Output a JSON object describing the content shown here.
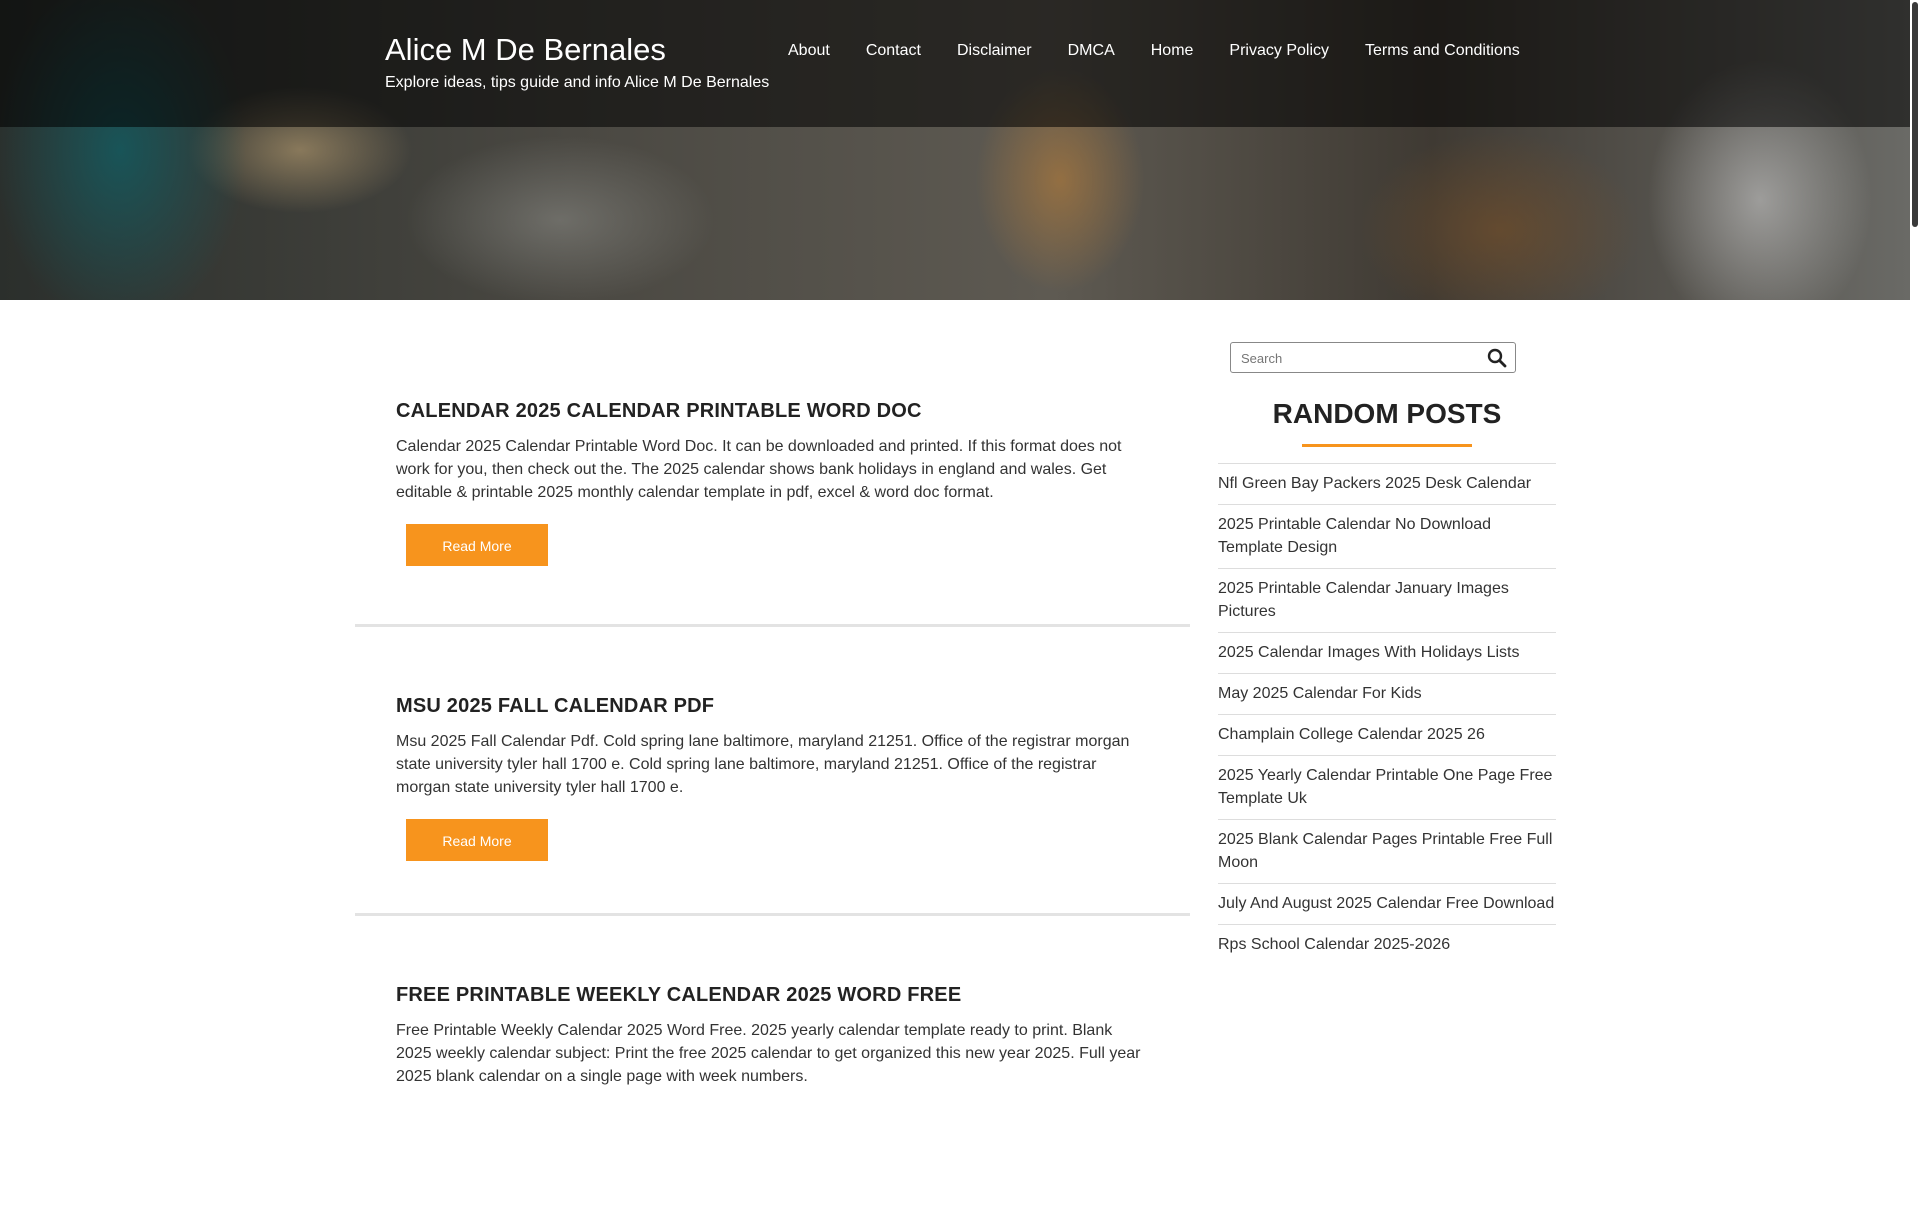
{
  "site": {
    "title": "Alice M De Bernales",
    "tagline": "Explore ideas, tips guide and info Alice M De Bernales"
  },
  "nav": {
    "items": [
      {
        "label": "About"
      },
      {
        "label": "Contact"
      },
      {
        "label": "Disclaimer"
      },
      {
        "label": "DMCA"
      },
      {
        "label": "Home"
      },
      {
        "label": "Privacy Policy"
      },
      {
        "label": "Terms and Conditions"
      }
    ]
  },
  "posts": [
    {
      "title": "CALENDAR 2025 CALENDAR PRINTABLE WORD DOC",
      "excerpt": "Calendar 2025 Calendar Printable Word Doc. It can be downloaded and printed. If this format does not work for you, then check out the. The 2025 calendar shows bank holidays in england and wales. Get editable & printable 2025 monthly calendar template in pdf, excel & word doc format.",
      "button": "Read More"
    },
    {
      "title": "MSU 2025 FALL CALENDAR PDF",
      "excerpt": "Msu 2025 Fall Calendar Pdf. Cold spring lane baltimore, maryland 21251. Office of the registrar morgan state university tyler hall 1700 e. Cold spring lane baltimore, maryland 21251. Office of the registrar morgan state university tyler hall 1700 e.",
      "button": "Read More"
    },
    {
      "title": "FREE PRINTABLE WEEKLY CALENDAR 2025 WORD FREE",
      "excerpt": "Free Printable Weekly Calendar 2025 Word Free. 2025 yearly calendar template ready to print. Blank 2025 weekly calendar subject: Print the free 2025 calendar to get organized this new year 2025. Full year 2025 blank calendar on a single page with week numbers."
    }
  ],
  "sidebar": {
    "search_placeholder": "Search",
    "search_icon": "magnifier-icon",
    "widget_title": "RANDOM POSTS",
    "random_posts": [
      "Nfl Green Bay Packers 2025 Desk Calendar",
      "2025 Printable Calendar No Download Template Design",
      "2025 Printable Calendar January Images Pictures",
      "2025 Calendar Images With Holidays Lists",
      "May 2025 Calendar For Kids",
      "Champlain College Calendar 2025 26",
      "2025 Yearly Calendar Printable One Page Free Template Uk",
      "2025 Blank Calendar Pages Printable Free Full Moon",
      "July And August 2025 Calendar Free Download",
      "Rps School Calendar 2025-2026"
    ]
  },
  "colors": {
    "accent": "#f7941d",
    "text": "#222222"
  }
}
